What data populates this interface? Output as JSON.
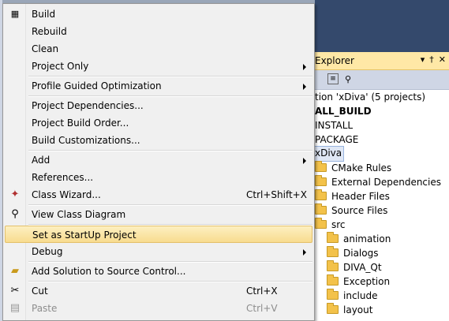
{
  "explorer": {
    "title": "Explorer",
    "pin": "†",
    "dropdown": "▾",
    "close": "✕",
    "solution_label": "tion 'xDiva' (5 projects)",
    "projects": [
      "ALL_BUILD",
      "INSTALL",
      "PACKAGE",
      "xDiva"
    ],
    "folders_level1": [
      "CMake Rules",
      "External Dependencies",
      "Header Files",
      "Source Files",
      "src"
    ],
    "folders_level2": [
      "animation",
      "Dialogs",
      "DIVA_Qt",
      "Exception",
      "include",
      "layout"
    ]
  },
  "menu": {
    "items": [
      {
        "label": "Build",
        "icon": "build-icon"
      },
      {
        "label": "Rebuild"
      },
      {
        "label": "Clean"
      },
      {
        "label": "Project Only",
        "submenu": true
      },
      {
        "label": "Profile Guided Optimization",
        "submenu": true
      },
      {
        "label": "Project Dependencies..."
      },
      {
        "label": "Project Build Order..."
      },
      {
        "label": "Build Customizations..."
      },
      {
        "label": "Add",
        "submenu": true
      },
      {
        "label": "References..."
      },
      {
        "label": "Class Wizard...",
        "shortcut": "Ctrl+Shift+X",
        "icon": "class-wizard-icon"
      },
      {
        "label": "View Class Diagram",
        "icon": "class-diagram-icon"
      },
      {
        "label": "Set as StartUp Project",
        "highlighted": true
      },
      {
        "label": "Debug",
        "submenu": true
      },
      {
        "label": "Add Solution to Source Control...",
        "icon": "source-control-icon"
      },
      {
        "label": "Cut",
        "shortcut": "Ctrl+X",
        "icon": "scissors-icon"
      },
      {
        "label": "Paste",
        "shortcut": "Ctrl+V",
        "icon": "paste-icon",
        "disabled": true
      }
    ]
  },
  "colors": {
    "highlight": "#f8dc8f",
    "explorer_title": "#ffe8a6",
    "background": "#34496c"
  }
}
